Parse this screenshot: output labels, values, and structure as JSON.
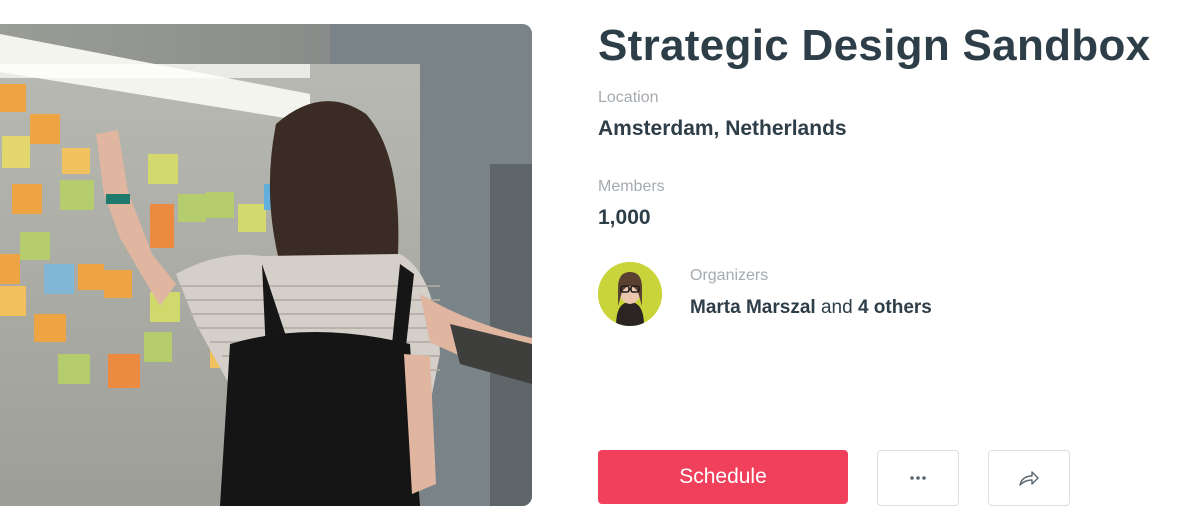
{
  "group": {
    "title": "Strategic Design Sandbox",
    "hero_image_icon": "group-photo"
  },
  "location": {
    "label": "Location",
    "value": "Amsterdam, Netherlands"
  },
  "members": {
    "label": "Members",
    "value": "1,000"
  },
  "organizers": {
    "label": "Organizers",
    "name": "Marta Marszal",
    "connector": " and ",
    "others": "4 others"
  },
  "actions": {
    "schedule_label": "Schedule",
    "more_icon": "ellipsis-icon",
    "share_icon": "share-arrow-icon"
  },
  "colors": {
    "primary_button": "#f0405c",
    "title_text": "#2e3e48",
    "label_text": "#a5abb0"
  }
}
